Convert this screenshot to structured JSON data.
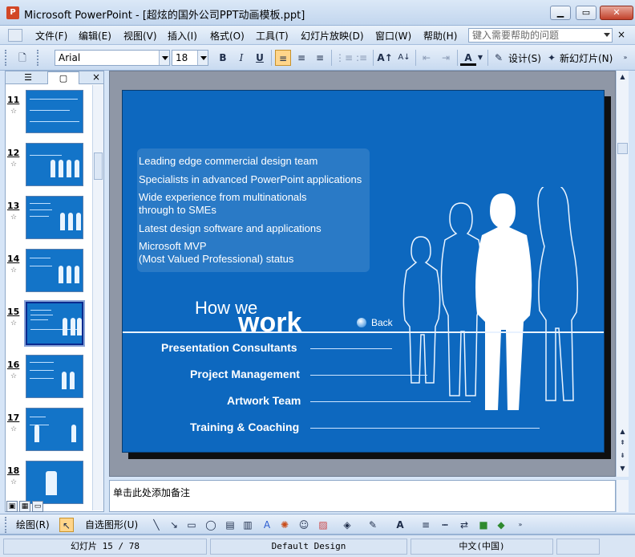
{
  "window": {
    "title": "Microsoft PowerPoint - [超炫的国外公司PPT动画模板.ppt]",
    "app_icon": "P"
  },
  "menu": {
    "items": [
      "文件(F)",
      "编辑(E)",
      "视图(V)",
      "插入(I)",
      "格式(O)",
      "工具(T)",
      "幻灯片放映(D)",
      "窗口(W)",
      "帮助(H)"
    ],
    "help_placeholder": "键入需要帮助的问题",
    "close": "×"
  },
  "toolbar": {
    "font": "Arial",
    "size": "18",
    "bold": "B",
    "italic": "I",
    "underline": "U",
    "design_label": "设计(S)",
    "new_slide_label": "新幻灯片(N)",
    "font_color_glyph": "A"
  },
  "left_pane": {
    "tab_outline": "☰",
    "tab_slides": "▢",
    "close": "×",
    "thumbnails": [
      {
        "num": "11",
        "star": "☆"
      },
      {
        "num": "12",
        "star": "☆"
      },
      {
        "num": "13",
        "star": "☆"
      },
      {
        "num": "14",
        "star": "☆"
      },
      {
        "num": "15",
        "star": "☆"
      },
      {
        "num": "16",
        "star": "☆"
      },
      {
        "num": "17",
        "star": "☆"
      },
      {
        "num": "18",
        "star": "☆"
      }
    ],
    "selected_slide": "15"
  },
  "slide": {
    "bullets": [
      "Leading edge commercial design team",
      "Specialists in advanced PowerPoint applications",
      "Wide experience from multinationals",
      "through to SMEs",
      "Latest design software and applications",
      "Microsoft MVP",
      "(Most Valued Professional) status"
    ],
    "how": "How we",
    "work": "work",
    "back": "Back",
    "services": [
      "Presentation Consultants",
      "Project Management",
      "Artwork Team",
      "Training & Coaching"
    ]
  },
  "notes": {
    "placeholder": "单击此处添加备注"
  },
  "drawbar": {
    "draw_label": "绘图(R)",
    "autoshapes_label": "自选图形(U)"
  },
  "status": {
    "slide_pos": "幻灯片 15 / 78",
    "design": "Default Design",
    "language": "中文(中国)"
  }
}
